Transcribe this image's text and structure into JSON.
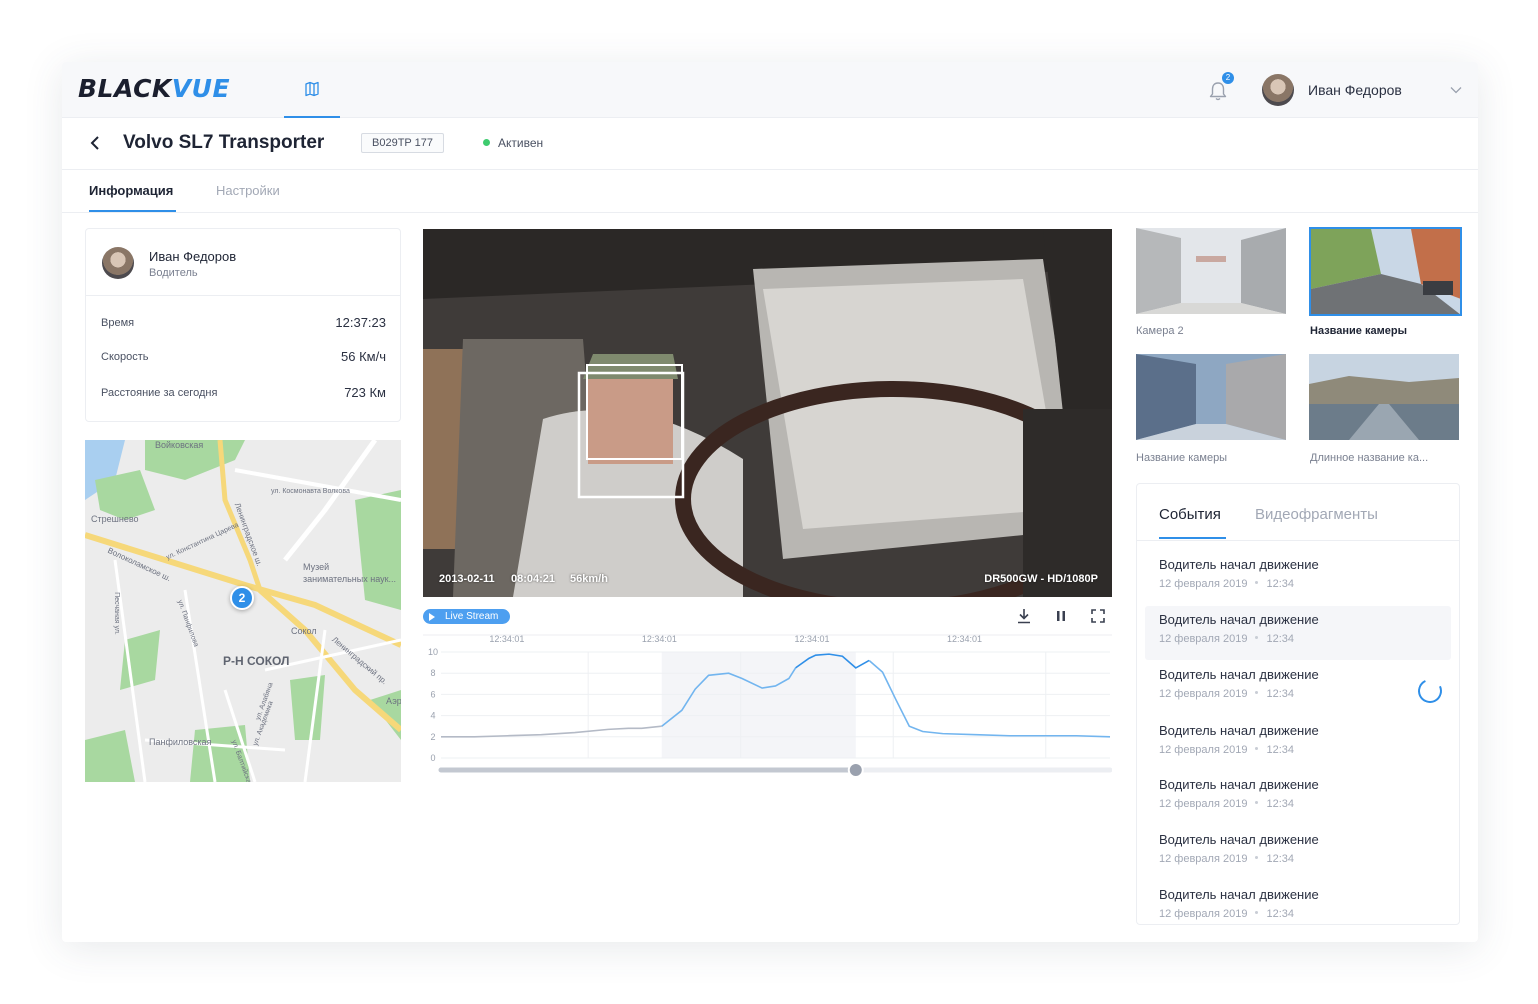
{
  "app": {
    "logo_black": "BLACK",
    "logo_blue": "VUE",
    "notification_count": "2",
    "user_name": "Иван Федоров"
  },
  "vehicle": {
    "title": "Volvo SL7 Transporter",
    "plate": "B029TP 177",
    "status": "Активен",
    "status_color": "#3ecb6e"
  },
  "tabs": {
    "info": "Информация",
    "settings": "Настройки"
  },
  "driver": {
    "name": "Иван Федоров",
    "role": "Водитель",
    "rows": [
      {
        "label": "Время",
        "value": "12:37:23"
      },
      {
        "label": "Скорость",
        "value": "56 Км/ч"
      },
      {
        "label": "Расстояние за сегодня",
        "value": "723 Км"
      }
    ]
  },
  "map": {
    "labels": [
      "Войковская",
      "ул. Космонавта Волкова",
      "Стрешнево",
      "ул. Константина Царева",
      "Волоколамское ш.",
      "Ленинградское ш.",
      "Музей",
      "занимательных наук...",
      "Песчаная ул.",
      "ул. Алабяна",
      "ул. Панфилова",
      "Сокол",
      "Ленинградский пр.",
      "Р-Н СОКОЛ",
      "Аэр",
      "Панфиловская",
      "ул. Академика",
      "ул. Балтийская"
    ],
    "marker": "2"
  },
  "video": {
    "date": "2013-02-11",
    "time": "08:04:21",
    "speed": "56km/h",
    "device": "DR500GW - HD/1080P"
  },
  "controls": {
    "live_label": "Live Stream"
  },
  "chart_data": {
    "type": "line",
    "x_ticks": [
      "12:34:01",
      "12:34:01",
      "12:34:01",
      "12:34:01"
    ],
    "y_ticks": [
      "10",
      "8",
      "6",
      "4",
      "2",
      "0"
    ],
    "ylim": [
      0,
      10
    ],
    "x": [
      0,
      5,
      10,
      15,
      20,
      25,
      28,
      30,
      33,
      36,
      38,
      40,
      43,
      45,
      48,
      50,
      52,
      53,
      55,
      56,
      58,
      60,
      62,
      64,
      66,
      68,
      70,
      72,
      75,
      80,
      85,
      90,
      95,
      100
    ],
    "values": [
      2.0,
      2.0,
      2.1,
      2.2,
      2.4,
      2.7,
      2.8,
      2.8,
      3.0,
      4.5,
      6.5,
      7.8,
      8.0,
      7.5,
      6.6,
      6.8,
      7.5,
      8.5,
      9.4,
      9.7,
      9.8,
      9.6,
      8.5,
      9.2,
      8.1,
      5.5,
      3.0,
      2.5,
      2.3,
      2.2,
      2.1,
      2.1,
      2.1,
      2.0
    ],
    "playhead": 62,
    "line_colors": [
      "#b4bac6",
      "#72b5ef",
      "#2f8fe8"
    ]
  },
  "cameras": [
    {
      "label": "Камера 2",
      "selected": false
    },
    {
      "label": "Название камеры",
      "selected": true
    },
    {
      "label": "Название камеры",
      "selected": false
    },
    {
      "label": "Длинное название ка...",
      "selected": false
    }
  ],
  "events": {
    "tab_events": "События",
    "tab_clips": "Видеофрагменты",
    "items": [
      {
        "title": "Водитель начал движение",
        "date": "12 февраля 2019",
        "time": "12:34"
      },
      {
        "title": "Водитель начал движение",
        "date": "12 февраля 2019",
        "time": "12:34"
      },
      {
        "title": "Водитель начал движение",
        "date": "12 февраля 2019",
        "time": "12:34"
      },
      {
        "title": "Водитель начал движение",
        "date": "12 февраля 2019",
        "time": "12:34"
      },
      {
        "title": "Водитель начал движение",
        "date": "12 февраля 2019",
        "time": "12:34"
      },
      {
        "title": "Водитель начал движение",
        "date": "12 февраля 2019",
        "time": "12:34"
      },
      {
        "title": "Водитель начал движение",
        "date": "12 февраля 2019",
        "time": "12:34"
      }
    ]
  },
  "colors": {
    "accent": "#2f8fe8",
    "text": "#2b3142",
    "muted": "#a2a8b5"
  }
}
